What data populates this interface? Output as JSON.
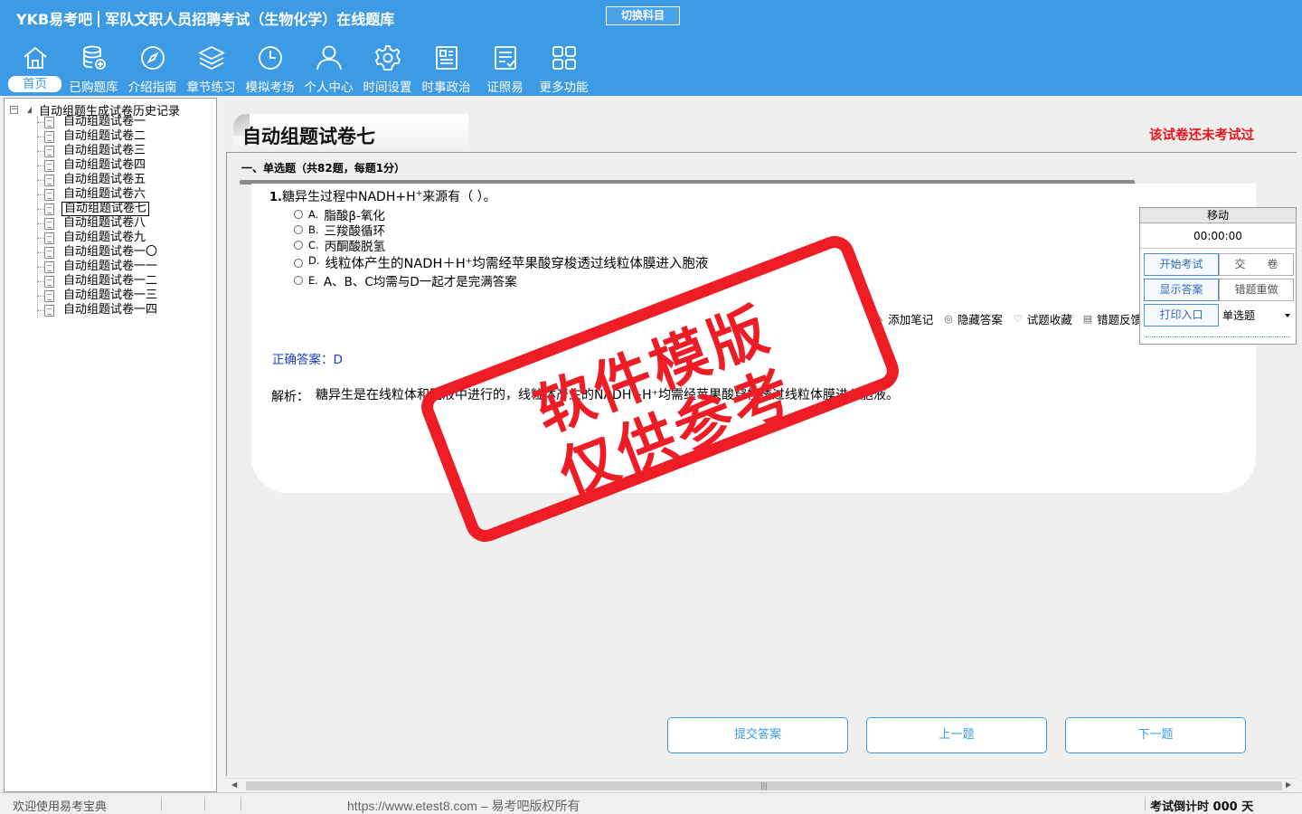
{
  "app": {
    "brand": "YKB易考吧",
    "title": "军队文职人员招聘考试（生物化学）在线题库",
    "switch_label": "切换科目"
  },
  "nav": [
    {
      "label": "首页",
      "icon": "home-icon",
      "active": true
    },
    {
      "label": "已购题库",
      "icon": "database-icon"
    },
    {
      "label": "介绍指南",
      "icon": "compass-icon"
    },
    {
      "label": "章节练习",
      "icon": "layers-icon"
    },
    {
      "label": "模拟考场",
      "icon": "clock-icon"
    },
    {
      "label": "个人中心",
      "icon": "user-icon"
    },
    {
      "label": "时间设置",
      "icon": "gear-icon"
    },
    {
      "label": "时事政治",
      "icon": "newspaper-icon"
    },
    {
      "label": "证照易",
      "icon": "certificate-icon"
    },
    {
      "label": "更多功能",
      "icon": "grid-icon"
    }
  ],
  "tree": {
    "root": "自动组题生成试卷历史记录",
    "items": [
      "自动组题试卷一",
      "自动组题试卷二",
      "自动组题试卷三",
      "自动组题试卷四",
      "自动组题试卷五",
      "自动组题试卷六",
      "自动组题试卷七",
      "自动组题试卷八",
      "自动组题试卷九",
      "自动组题试卷一〇",
      "自动组题试卷一一",
      "自动组题试卷一二",
      "自动组题试卷一三",
      "自动组题试卷一四"
    ],
    "selected_index": 6
  },
  "exam": {
    "title": "自动组题试卷七",
    "status": "该试卷还未考试过",
    "section": "一、单选题（共82题，每题1分）"
  },
  "question": {
    "number": "1.",
    "stem_prefix": "糖异生过程中NADH+H",
    "stem_sup": "+",
    "stem_suffix": "来源有（   ）。",
    "options": [
      {
        "key": "A.",
        "text": "脂酸β-氧化"
      },
      {
        "key": "B.",
        "text": "三羧酸循环"
      },
      {
        "key": "C.",
        "text": "丙酮酸脱氢"
      },
      {
        "key": "D.",
        "text": "线粒体产生的NADH＋H⁺均需经苹果酸穿梭透过线粒体膜进入胞液"
      },
      {
        "key": "E.",
        "text": "A、B、C均需与D一起才是完满答案"
      }
    ],
    "answer_label": "正确答案：",
    "answer_value": "D",
    "analysis_label": "解析：",
    "analysis_text": "糖异生是在线粒体和胞液中进行的，线粒体产生的NADH+H⁺均需经苹果酸穿梭透过线粒体膜进入胞液。"
  },
  "tools": [
    {
      "label": "添加笔记",
      "icon": "note-icon"
    },
    {
      "label": "隐藏答案",
      "icon": "eye-icon"
    },
    {
      "label": "试题收藏",
      "icon": "heart-icon"
    },
    {
      "label": "错题反馈",
      "icon": "feedback-icon"
    }
  ],
  "timer": {
    "header": "移动",
    "value": "00:00:00",
    "start": "开始考试",
    "submit_paper": "交　　卷",
    "show_answer": "显示答案",
    "redo_wrong": "错题重做",
    "print": "打印入口",
    "type_select": "单选题"
  },
  "buttons": {
    "submit": "提交答案",
    "prev": "上一题",
    "next": "下一题"
  },
  "status": {
    "welcome": "欢迎使用易考宝典",
    "copyright": "https://www.etest8.com – 易考吧版权所有",
    "countdown": "考试倒计时 000 天"
  },
  "watermark": {
    "line1": "软件模版",
    "line2": "仅供参考"
  },
  "colors": {
    "header_blue": "#3d9be6",
    "status_red": "#e8161c",
    "answer_blue": "#1a3fc0",
    "stamp_red": "#ee1c25"
  }
}
